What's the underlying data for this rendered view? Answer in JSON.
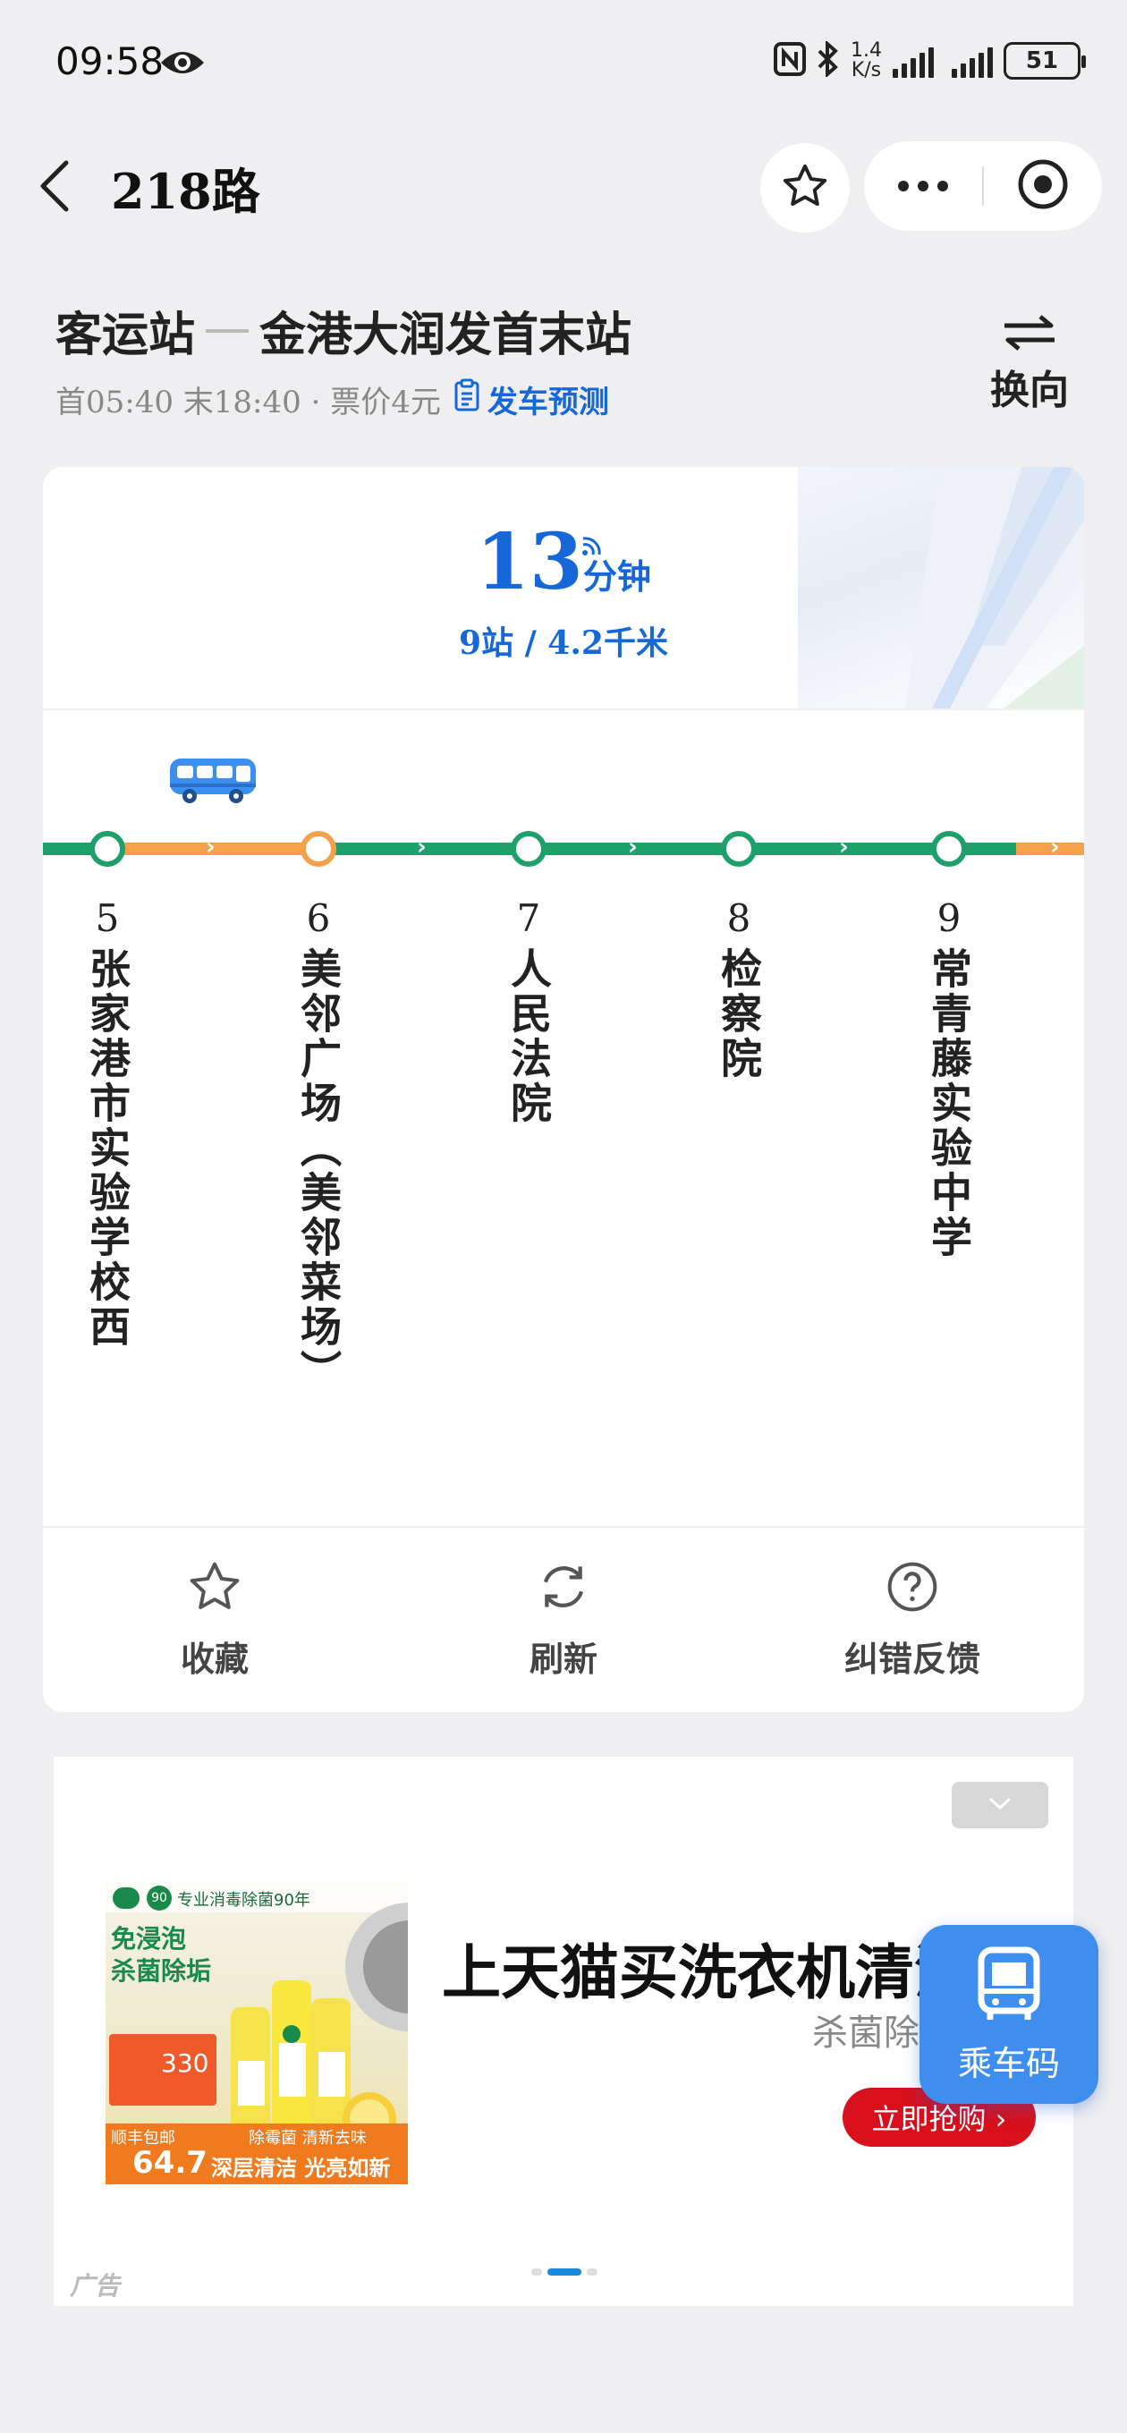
{
  "status_bar": {
    "time": "09:58",
    "speed_value": "1.4",
    "speed_unit": "K/s",
    "battery": "51"
  },
  "nav": {
    "title": "218路"
  },
  "route": {
    "from": "客运站",
    "to": "金港大润发首末站",
    "info": "首05:40 末18:40 · 票价4元",
    "predict_label": "发车预测",
    "switch_label": "换向"
  },
  "eta": {
    "minutes": "13",
    "unit": "分钟",
    "detail": "9站 / 4.2千米"
  },
  "stops": [
    {
      "num": "5",
      "name": "张家港市实验学校西"
    },
    {
      "num": "6",
      "name": "美邻广场（美邻菜场）"
    },
    {
      "num": "7",
      "name": "人民法院"
    },
    {
      "num": "8",
      "name": "检察院"
    },
    {
      "num": "9",
      "name": "常青藤实验中学"
    }
  ],
  "actions": {
    "favorite": "收藏",
    "refresh": "刷新",
    "feedback": "纠错反馈"
  },
  "ad": {
    "title": "上天猫买洗衣机清洗剂",
    "subtitle": "杀菌除垢财富",
    "buy_label": "立即抢购 ›",
    "label": "广告",
    "img_brand_line": "专业消毒除菌90年",
    "img_headline_1": "免浸泡",
    "img_headline_2": "杀菌除垢",
    "img_price_small": "330",
    "img_bottom_left": "顺丰包邮",
    "img_price": "64.7",
    "img_bottom_tag": "除霉菌 清新去味",
    "img_bottom_slogan": "深层清洁 光亮如新"
  },
  "ride_code": {
    "label": "乘车码"
  },
  "colors": {
    "accent": "#1668d8",
    "line_green": "#1ea06b",
    "line_orange": "#f5a04a",
    "ad_red": "#d8101c",
    "ride_blue": "#3e8ef0"
  }
}
